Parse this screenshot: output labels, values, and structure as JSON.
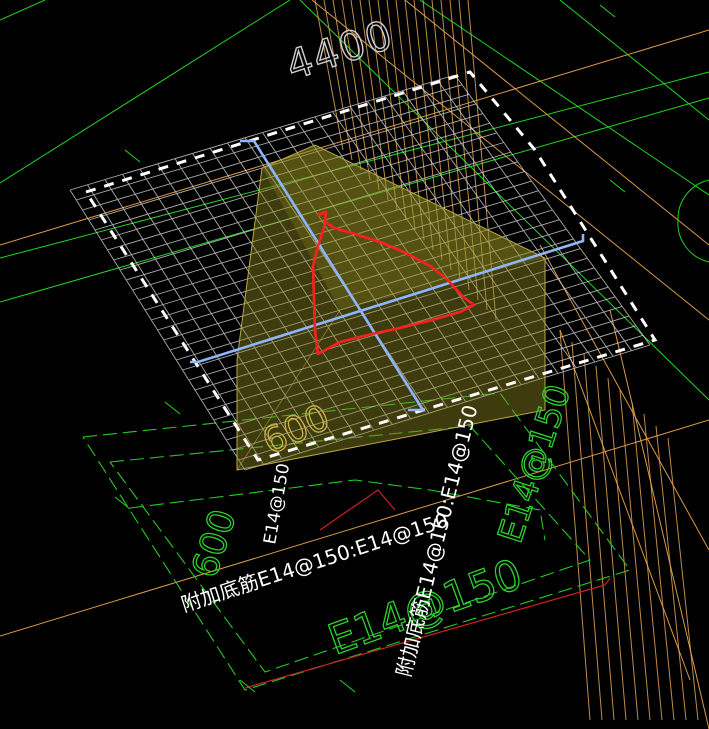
{
  "colors": {
    "background": "#000000",
    "axis_green": "#1fd81f",
    "dash_green": "#22cc22",
    "rebar_grid": "#d8d8d8",
    "footing_fill": "#8a8520",
    "footing_edge": "#b9a84a",
    "boundary_dash": "#ffffff",
    "column_axis": "#8fb6ff",
    "markup_red": "#ff2020",
    "orange_lines": "#d99a4a",
    "dim_red": "#cc2222"
  },
  "icons": {
    "view_cube": "none",
    "markup": "freehand-red-outline"
  },
  "drawing": {
    "dimension_label": "4400",
    "rebar_label_horizontal": "附加底筋E14@150:E14@150",
    "rebar_label_vertical": "附加底筋E14@150:E14@150",
    "rebar_tag_diagonal": "E14@150",
    "green_tag_left": "E14@150",
    "green_tag_bottom": "E14@150",
    "green_tag_right": "E14@150",
    "green_num_a": "600",
    "green_num_b": "600"
  }
}
